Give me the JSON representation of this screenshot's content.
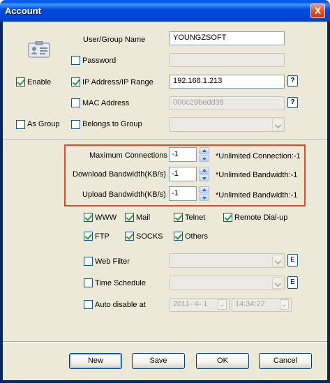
{
  "window": {
    "title": "Account",
    "close_glyph": "X",
    "title_bar_color": "#0054e3"
  },
  "identity": {
    "name_label": "User/Group Name",
    "name_value": "YOUNGZSOFT",
    "password_label": "Password",
    "password_checked": false,
    "enable_label": "Enable",
    "enable_checked": true,
    "ip_label": "IP Address/IP Range",
    "ip_checked": true,
    "ip_value": "192.168.1.213",
    "ip_help": "?",
    "mac_label": "MAC Address",
    "mac_checked": false,
    "mac_value": "000c29bedd38",
    "mac_help": "?",
    "as_group_label": "As Group",
    "as_group_checked": false,
    "belongs_label": "Belongs to Group",
    "belongs_checked": false,
    "icon": "id-card-icon"
  },
  "limits": {
    "highlight_color": "#e04a24",
    "max_conn_label": "Maximum Connections",
    "max_conn_value": "-1",
    "max_conn_hint": "*Unlimited Connection:-1",
    "download_label": "Download Bandwidth(KB/s)",
    "download_value": "-1",
    "download_hint": "*Unlimited Bandwidth:-1",
    "upload_label": "Upload Bandwidth(KB/s)",
    "upload_value": "-1",
    "upload_hint": "*Unlimited Bandwidth:-1"
  },
  "services": {
    "www": "WWW",
    "mail": "Mail",
    "telnet": "Telnet",
    "dialup": "Remote Dial-up",
    "ftp": "FTP",
    "socks": "SOCKS",
    "others": "Others"
  },
  "options": {
    "web_filter_label": "Web Filter",
    "web_filter_checked": false,
    "web_filter_edit": "E",
    "schedule_label": "Time Schedule",
    "schedule_checked": false,
    "schedule_edit": "E",
    "auto_disable_label": "Auto disable at",
    "auto_disable_checked": false,
    "auto_disable_date": "2011- 4- 1",
    "auto_disable_time": "14:34:27"
  },
  "buttons": {
    "new": "New",
    "save": "Save",
    "ok": "OK",
    "cancel": "Cancel"
  }
}
